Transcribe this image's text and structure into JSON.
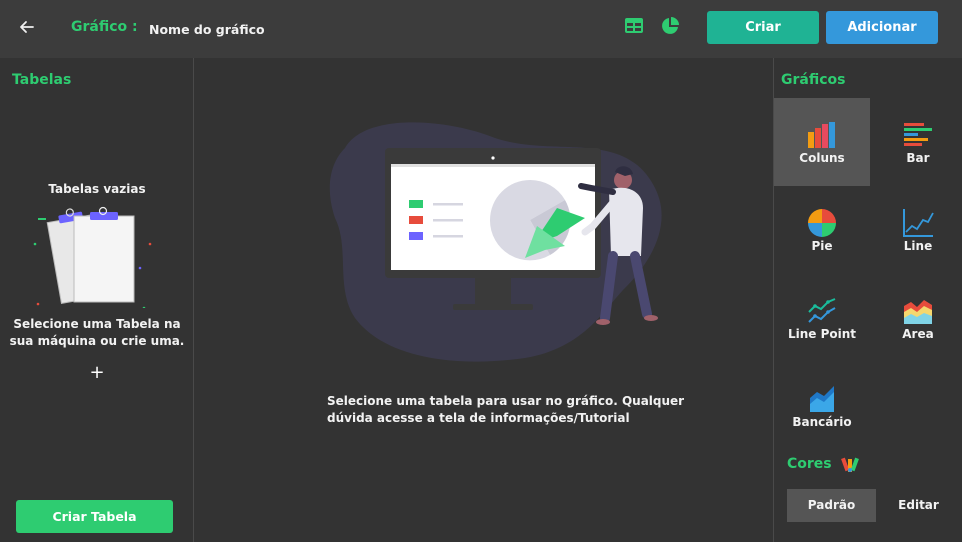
{
  "header": {
    "chart_label": "Gráfico :",
    "chart_name": "Nome do gráfico",
    "create_button": "Criar",
    "add_button": "Adicionar"
  },
  "left_panel": {
    "title": "Tabelas",
    "empty_title": "Tabelas vazias",
    "empty_desc_line1": "Selecione uma Tabela na",
    "empty_desc_line2": "sua máquina ou crie uma.",
    "add_symbol": "+",
    "create_table_button": "Criar Tabela"
  },
  "center": {
    "message_line1": "Selecione uma tabela para usar no gráfico. Qualquer",
    "message_line2": "dúvida acesse a tela de informações/Tutorial"
  },
  "right_panel": {
    "title": "Gráficos",
    "chart_types": [
      {
        "label": "Coluns",
        "icon": "column-chart-icon",
        "active": true
      },
      {
        "label": "Bar",
        "icon": "bar-chart-icon",
        "active": false
      },
      {
        "label": "Pie",
        "icon": "pie-chart-icon",
        "active": false
      },
      {
        "label": "Line",
        "icon": "line-chart-icon",
        "active": false
      },
      {
        "label": "Line Point",
        "icon": "line-point-chart-icon",
        "active": false
      },
      {
        "label": "Area",
        "icon": "area-chart-icon",
        "active": false
      },
      {
        "label": "Bancário",
        "icon": "banking-chart-icon",
        "active": false
      }
    ],
    "colors_title": "Cores",
    "colors_default": "Padrão",
    "colors_edit": "Editar"
  },
  "colors": {
    "accent_green": "#2ecc71",
    "teal": "#1fb394",
    "blue": "#3498db",
    "background": "#333333",
    "header": "#3c3c3c"
  }
}
